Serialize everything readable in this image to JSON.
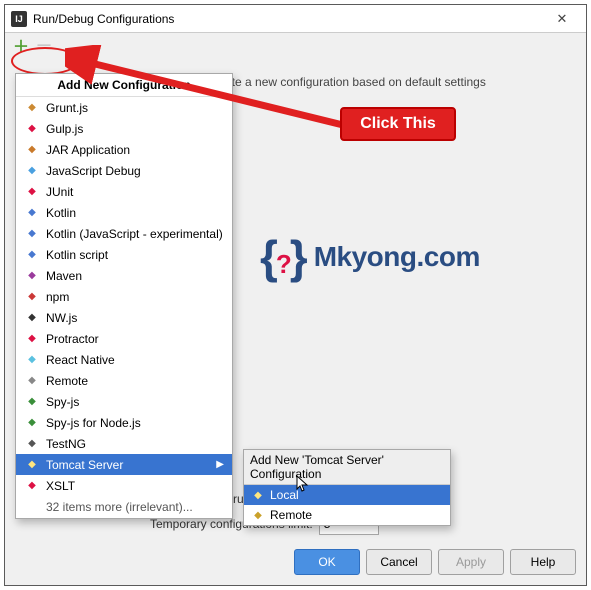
{
  "window": {
    "title": "Run/Debug Configurations"
  },
  "hint": "to create a new configuration based on default settings",
  "menu": {
    "heading": "Add New Configuration",
    "items": [
      {
        "label": "Grunt.js",
        "color": "#cc8a33"
      },
      {
        "label": "Gulp.js",
        "color": "#d14"
      },
      {
        "label": "JAR Application",
        "color": "#c97a2b"
      },
      {
        "label": "JavaScript Debug",
        "color": "#4aa0e0"
      },
      {
        "label": "JUnit",
        "color": "#d14"
      },
      {
        "label": "Kotlin",
        "color": "#4878d0"
      },
      {
        "label": "Kotlin (JavaScript - experimental)",
        "color": "#4878d0"
      },
      {
        "label": "Kotlin script",
        "color": "#4878d0"
      },
      {
        "label": "Maven",
        "color": "#9a3b9c"
      },
      {
        "label": "npm",
        "color": "#cb3837"
      },
      {
        "label": "NW.js",
        "color": "#333"
      },
      {
        "label": "Protractor",
        "color": "#d14"
      },
      {
        "label": "React Native",
        "color": "#5bc1e0"
      },
      {
        "label": "Remote",
        "color": "#888"
      },
      {
        "label": "Spy-js",
        "color": "#3a8f3a"
      },
      {
        "label": "Spy-js for Node.js",
        "color": "#3a8f3a"
      },
      {
        "label": "TestNG",
        "color": "#555"
      },
      {
        "label": "Tomcat Server",
        "selected": true,
        "hasSub": true,
        "color": "#caa12a"
      },
      {
        "label": "XSLT",
        "color": "#d14"
      }
    ],
    "more": "32 items more (irrelevant)..."
  },
  "submenu": {
    "heading": "Add New 'Tomcat Server' Configuration",
    "items": [
      {
        "label": "Local",
        "selected": true
      },
      {
        "label": "Remote",
        "selected": false
      }
    ]
  },
  "bottom": {
    "checkbox_label": "Confirm rerun with process termination",
    "limit_label": "Temporary configurations limit:",
    "limit_value": "5"
  },
  "buttons": {
    "ok": "OK",
    "cancel": "Cancel",
    "apply": "Apply",
    "help": "Help"
  },
  "callout": "Click This",
  "logo": "Mkyong.com"
}
